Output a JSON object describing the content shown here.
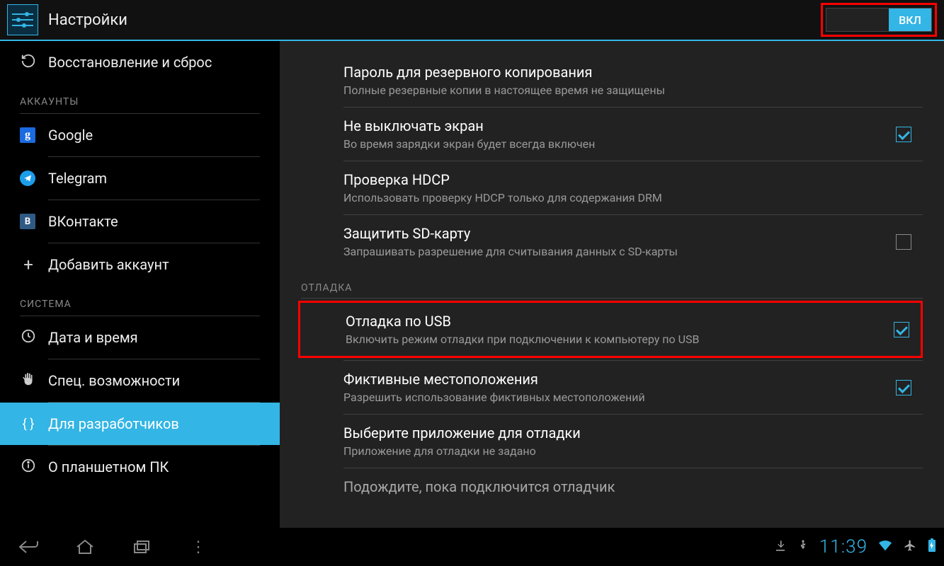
{
  "header": {
    "title": "Настройки",
    "switch_on": "ВКЛ"
  },
  "sidebar": {
    "restore": "Восстановление и сброс",
    "section_accounts": "АККАУНТЫ",
    "google": "Google",
    "telegram": "Telegram",
    "vk": "ВКонтакте",
    "add_account": "Добавить аккаунт",
    "section_system": "СИСТЕМА",
    "datetime": "Дата и время",
    "accessibility": "Спец. возможности",
    "developer": "Для разработчиков",
    "about": "О планшетном ПК"
  },
  "content": {
    "backup_pw": {
      "title": "Пароль для резервного копирования",
      "sub": "Полные резервные копии в настоящее время не защищены"
    },
    "stay_awake": {
      "title": "Не выключать экран",
      "sub": "Во время зарядки экран будет всегда включен"
    },
    "hdcp": {
      "title": "Проверка HDCP",
      "sub": "Использовать проверку HDCP только для содержания DRM"
    },
    "sd": {
      "title": "Защитить SD-карту",
      "sub": "Запрашивать разрешение для считывания данных с SD-карты"
    },
    "section_debug": "ОТЛАДКА",
    "usb_debug": {
      "title": "Отладка по USB",
      "sub": "Включить режим отладки при подключении к компьютеру по USB"
    },
    "mock_loc": {
      "title": "Фиктивные местоположения",
      "sub": "Разрешить использование фиктивных местоположений"
    },
    "debug_app": {
      "title": "Выберите приложение для отладки",
      "sub": "Приложение для отладки не задано"
    },
    "wait_debugger": {
      "title": "Подождите, пока подключится отладчик"
    }
  },
  "status": {
    "time": "11:39"
  }
}
